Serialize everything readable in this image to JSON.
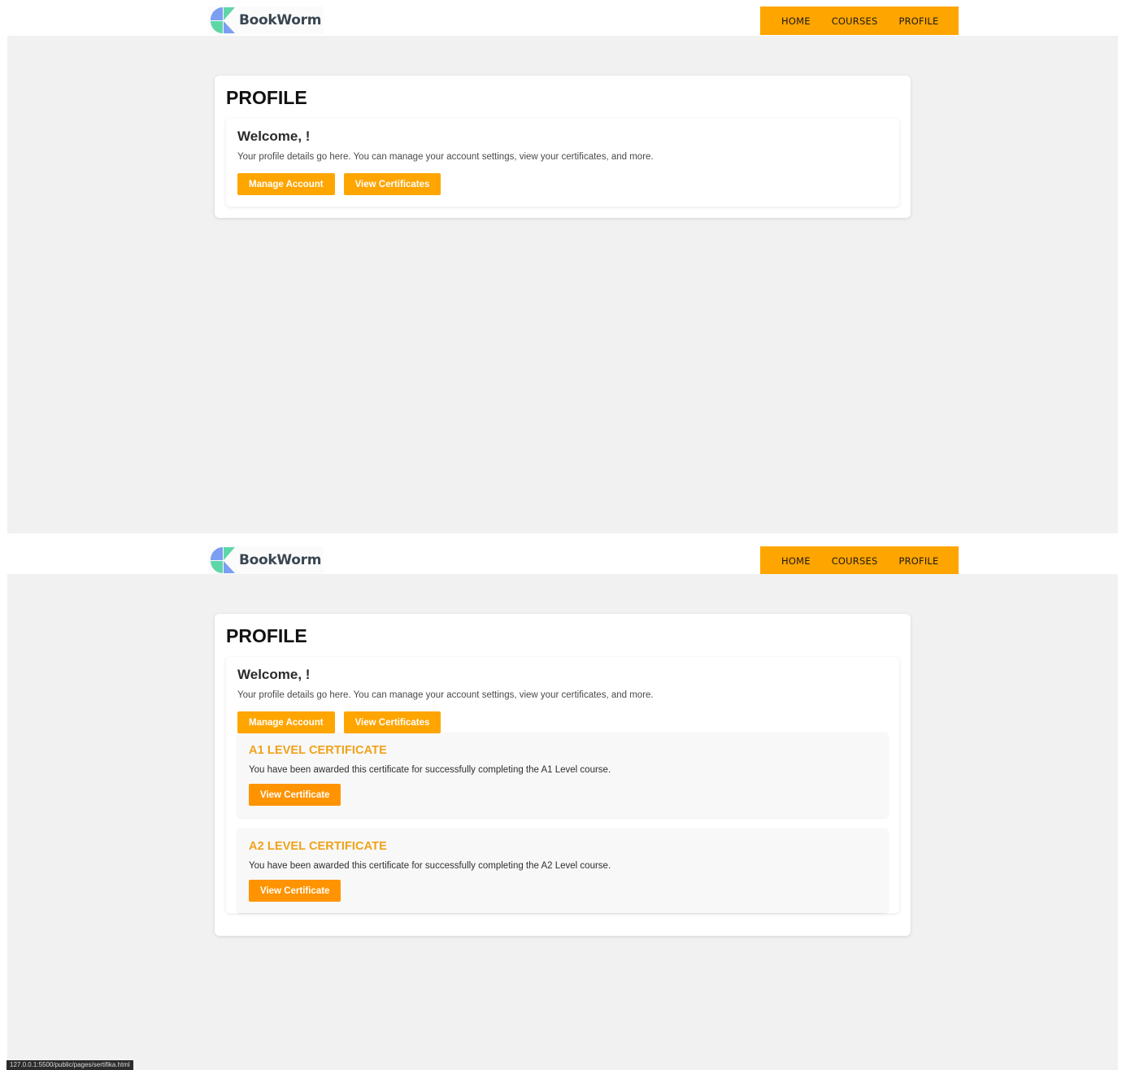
{
  "header": {
    "brand": "BookWorm",
    "nav": [
      {
        "label": "HOME"
      },
      {
        "label": "COURSES"
      },
      {
        "label": "PROFILE"
      }
    ],
    "accent_color": "#ffa500"
  },
  "profile": {
    "title": "PROFILE",
    "welcome": "Welcome, !",
    "description": "Your profile details go here. You can manage your account settings, view your certificates, and more.",
    "manage_label": "Manage Account",
    "certificates_label": "View Certificates"
  },
  "certificates": [
    {
      "title": "A1 LEVEL CERTIFICATE",
      "text": "You have been awarded this certificate for successfully completing the A1 Level course.",
      "button": "View Certificate"
    },
    {
      "title": "A2 LEVEL CERTIFICATE",
      "text": "You have been awarded this certificate for successfully completing the A2 Level course.",
      "button": "View Certificate"
    }
  ],
  "status_bar": {
    "url": "127.0.0.1:5500/public/pages/sertifika.html"
  }
}
